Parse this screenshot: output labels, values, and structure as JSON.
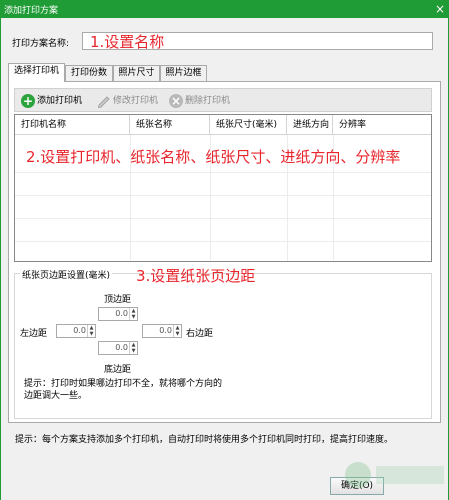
{
  "window": {
    "title": "添加打印方案",
    "close_glyph": "×"
  },
  "scheme_name": {
    "label": "打印方案名称:",
    "value": ""
  },
  "annotations": {
    "step1": "1.设置名称",
    "step2": "2.设置打印机、纸张名称、纸张尺寸、进纸方向、分辨率",
    "step3": "3.设置纸张页边距"
  },
  "tabs": [
    {
      "label": "选择打印机",
      "active": true
    },
    {
      "label": "打印份数"
    },
    {
      "label": "照片尺寸"
    },
    {
      "label": "照片边框"
    }
  ],
  "toolbar": {
    "add": {
      "label": "添加打印机",
      "icon": "add-icon"
    },
    "edit": {
      "label": "修改打印机",
      "icon": "pencil-icon"
    },
    "delete": {
      "label": "删除打印机",
      "icon": "delete-icon"
    }
  },
  "grid": {
    "columns": [
      "打印机名称",
      "纸张名称",
      "纸张尺寸(毫米)",
      "进纸方向",
      "分辨率"
    ],
    "rows": []
  },
  "margins": {
    "title": "纸张页边距设置(毫米)",
    "top_label": "顶边距",
    "top_value": "0.0",
    "left_label": "左边距",
    "left_value": "0.0",
    "right_label": "右边距",
    "right_value": "0.0",
    "bottom_label": "底边距",
    "bottom_value": "0.0"
  },
  "tip": "提示：打印时如果哪边打印不全，就将哪个方向的边距调大一些。",
  "footer_tip": "提示：每个方案支持添加多个打印机，自动打印时将使用多个打印机同时打印，提高打印速度。",
  "buttons": {
    "ok": "确定(O)"
  },
  "colors": {
    "titlebar": "#1f9c36",
    "annotation": "#e8262c",
    "add_icon": "#2ca33c"
  }
}
